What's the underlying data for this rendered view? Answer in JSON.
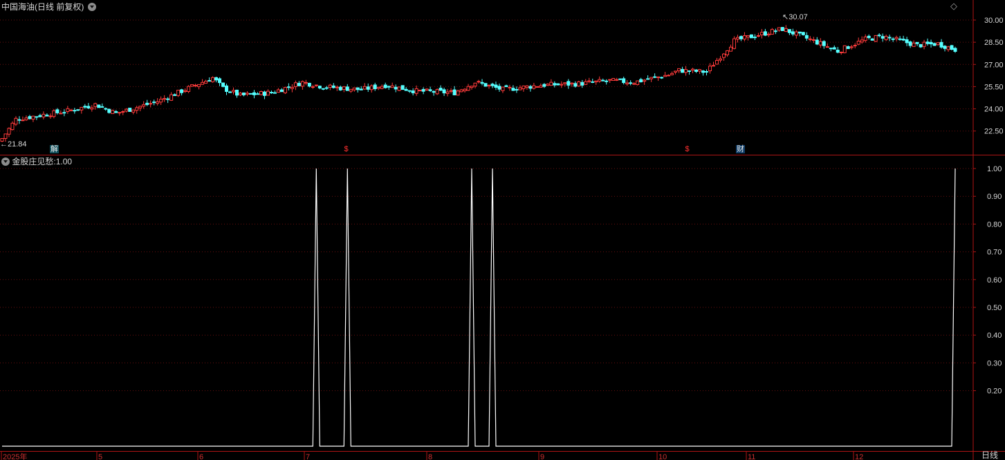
{
  "main_title": "中国海油(日线 前复权)",
  "indicator_title": "金股庄见愁",
  "indicator_value": "1.00",
  "period_label": "日线",
  "colors": {
    "up": "#ff3b3b",
    "down": "#54ffff",
    "axis": "#b01515",
    "grid": "#6a0f0f",
    "line": "#ffffff",
    "text": "#d8d8d8"
  },
  "icons": [
    "dropdown-circle-icon",
    "diamond-icon",
    "arrow-left-icon"
  ],
  "markers": [
    {
      "label": "解",
      "style": "box"
    },
    {
      "label": "$",
      "style": "red"
    },
    {
      "label": "$",
      "style": "red"
    },
    {
      "label": "财",
      "style": "box"
    }
  ],
  "annotations": {
    "low": "21.84",
    "high": "30.07"
  },
  "chart_data": [
    {
      "type": "candlestick",
      "title": "中国海油(日线 前复权)",
      "y_ticks": [
        "22.50",
        "24.00",
        "25.50",
        "27.00",
        "28.50",
        "30.00"
      ],
      "ylim": [
        20.9,
        30.7
      ],
      "x_ticks": [
        "2025年",
        "5",
        "6",
        "7",
        "8",
        "9",
        "10",
        "11",
        "12"
      ],
      "close_anchors": [
        [
          0,
          22.0
        ],
        [
          4,
          23.3
        ],
        [
          12,
          23.6
        ],
        [
          20,
          23.9
        ],
        [
          27,
          24.3
        ],
        [
          33,
          23.7
        ],
        [
          45,
          24.5
        ],
        [
          55,
          25.5
        ],
        [
          61,
          26.1
        ],
        [
          64,
          25.4
        ],
        [
          69,
          24.9
        ],
        [
          78,
          25.1
        ],
        [
          87,
          25.8
        ],
        [
          93,
          25.5
        ],
        [
          104,
          25.3
        ],
        [
          111,
          25.6
        ],
        [
          120,
          25.2
        ],
        [
          131,
          25.1
        ],
        [
          137,
          25.8
        ],
        [
          145,
          25.3
        ],
        [
          156,
          25.6
        ],
        [
          167,
          25.7
        ],
        [
          176,
          25.9
        ],
        [
          183,
          25.8
        ],
        [
          193,
          26.3
        ],
        [
          196,
          26.6
        ],
        [
          204,
          26.5
        ],
        [
          212,
          28.6
        ],
        [
          226,
          29.4
        ],
        [
          236,
          28.5
        ],
        [
          242,
          27.9
        ],
        [
          250,
          28.7
        ],
        [
          255,
          28.9
        ],
        [
          265,
          28.3
        ],
        [
          271,
          28.4
        ],
        [
          276,
          28.0
        ]
      ],
      "low_label": "21.84",
      "high_label": "30.07"
    },
    {
      "type": "line",
      "title": "金股庄见愁",
      "y_ticks": [
        "0.20",
        "0.30",
        "0.40",
        "0.50",
        "0.60",
        "0.70",
        "0.80",
        "0.90",
        "1.00"
      ],
      "ylim": [
        0,
        1
      ],
      "spikes": [
        91,
        100,
        136,
        142,
        276
      ],
      "total_bars": 277
    }
  ]
}
